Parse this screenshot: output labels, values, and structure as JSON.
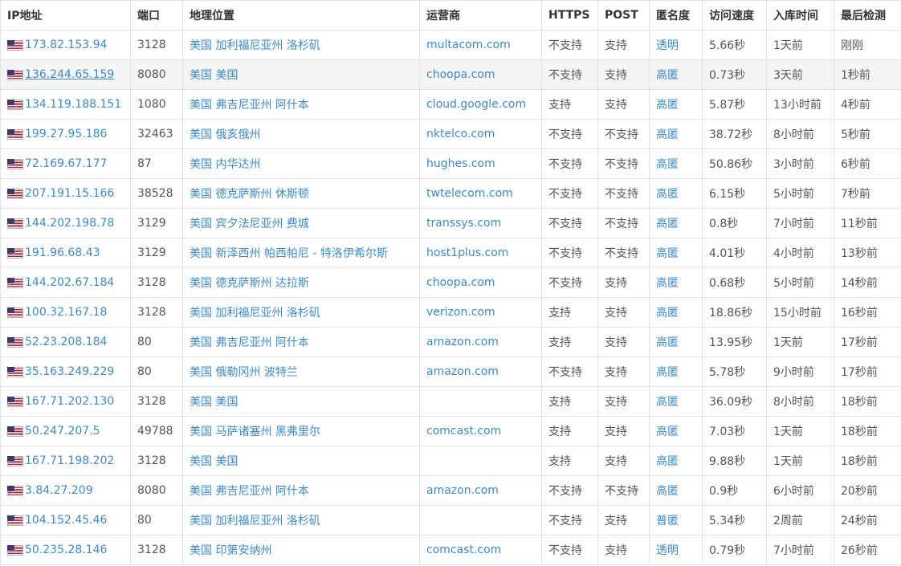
{
  "headers": [
    "IP地址",
    "端口",
    "地理位置",
    "运营商",
    "HTTPS",
    "POST",
    "匿名度",
    "访问速度",
    "入库时间",
    "最后检测"
  ],
  "rows": [
    {
      "ip": "173.82.153.94",
      "port": "3128",
      "location": "美国 加利福尼亚州 洛杉矶",
      "isp": "multacom.com",
      "https": "不支持",
      "post": "支持",
      "anon": "透明",
      "speed": "5.66秒",
      "added": "1天前",
      "checked": "刚刚"
    },
    {
      "ip": "136.244.65.159",
      "port": "8080",
      "location": "美国 美国",
      "isp": "choopa.com",
      "https": "不支持",
      "post": "支持",
      "anon": "高匿",
      "speed": "0.73秒",
      "added": "3天前",
      "checked": "1秒前"
    },
    {
      "ip": "134.119.188.151",
      "port": "1080",
      "location": "美国 弗吉尼亚州 阿什本",
      "isp": "cloud.google.com",
      "https": "支持",
      "post": "支持",
      "anon": "高匿",
      "speed": "5.87秒",
      "added": "13小时前",
      "checked": "4秒前"
    },
    {
      "ip": "199.27.95.186",
      "port": "32463",
      "location": "美国 俄亥俄州",
      "isp": "nktelco.com",
      "https": "不支持",
      "post": "不支持",
      "anon": "高匿",
      "speed": "38.72秒",
      "added": "8小时前",
      "checked": "5秒前"
    },
    {
      "ip": "72.169.67.177",
      "port": "87",
      "location": "美国 内华达州",
      "isp": "hughes.com",
      "https": "不支持",
      "post": "不支持",
      "anon": "高匿",
      "speed": "50.86秒",
      "added": "3小时前",
      "checked": "6秒前"
    },
    {
      "ip": "207.191.15.166",
      "port": "38528",
      "location": "美国 德克萨斯州 休斯顿",
      "isp": "twtelecom.com",
      "https": "不支持",
      "post": "不支持",
      "anon": "高匿",
      "speed": "6.15秒",
      "added": "5小时前",
      "checked": "7秒前"
    },
    {
      "ip": "144.202.198.78",
      "port": "3129",
      "location": "美国 宾夕法尼亚州 费城",
      "isp": "transsys.com",
      "https": "不支持",
      "post": "不支持",
      "anon": "高匿",
      "speed": "0.8秒",
      "added": "7小时前",
      "checked": "11秒前"
    },
    {
      "ip": "191.96.68.43",
      "port": "3129",
      "location": "美国 新泽西州 帕西帕尼 - 特洛伊希尔斯",
      "isp": "host1plus.com",
      "https": "不支持",
      "post": "不支持",
      "anon": "高匿",
      "speed": "4.01秒",
      "added": "4小时前",
      "checked": "13秒前"
    },
    {
      "ip": "144.202.67.184",
      "port": "3128",
      "location": "美国 德克萨斯州 达拉斯",
      "isp": "choopa.com",
      "https": "不支持",
      "post": "支持",
      "anon": "高匿",
      "speed": "0.68秒",
      "added": "5小时前",
      "checked": "14秒前"
    },
    {
      "ip": "100.32.167.18",
      "port": "3128",
      "location": "美国 加利福尼亚州 洛杉矶",
      "isp": "verizon.com",
      "https": "支持",
      "post": "支持",
      "anon": "高匿",
      "speed": "18.86秒",
      "added": "15小时前",
      "checked": "16秒前"
    },
    {
      "ip": "52.23.208.184",
      "port": "80",
      "location": "美国 弗吉尼亚州 阿什本",
      "isp": "amazon.com",
      "https": "支持",
      "post": "支持",
      "anon": "高匿",
      "speed": "13.95秒",
      "added": "1天前",
      "checked": "17秒前"
    },
    {
      "ip": "35.163.249.229",
      "port": "80",
      "location": "美国 俄勒冈州 波特兰",
      "isp": "amazon.com",
      "https": "不支持",
      "post": "支持",
      "anon": "高匿",
      "speed": "5.78秒",
      "added": "9小时前",
      "checked": "17秒前"
    },
    {
      "ip": "167.71.202.130",
      "port": "3128",
      "location": "美国 美国",
      "isp": "",
      "https": "支持",
      "post": "支持",
      "anon": "高匿",
      "speed": "36.09秒",
      "added": "8小时前",
      "checked": "18秒前"
    },
    {
      "ip": "50.247.207.5",
      "port": "49788",
      "location": "美国 马萨诸塞州 黑弗里尔",
      "isp": "comcast.com",
      "https": "支持",
      "post": "支持",
      "anon": "高匿",
      "speed": "7.03秒",
      "added": "1天前",
      "checked": "18秒前"
    },
    {
      "ip": "167.71.198.202",
      "port": "3128",
      "location": "美国 美国",
      "isp": "",
      "https": "支持",
      "post": "支持",
      "anon": "高匿",
      "speed": "9.88秒",
      "added": "1天前",
      "checked": "18秒前"
    },
    {
      "ip": "3.84.27.209",
      "port": "8080",
      "location": "美国 弗吉尼亚州 阿什本",
      "isp": "amazon.com",
      "https": "不支持",
      "post": "不支持",
      "anon": "高匿",
      "speed": "0.9秒",
      "added": "6小时前",
      "checked": "20秒前"
    },
    {
      "ip": "104.152.45.46",
      "port": "80",
      "location": "美国 加利福尼亚州 洛杉矶",
      "isp": "",
      "https": "不支持",
      "post": "支持",
      "anon": "普匿",
      "speed": "5.34秒",
      "added": "2周前",
      "checked": "24秒前"
    },
    {
      "ip": "50.235.28.146",
      "port": "3128",
      "location": "美国 印第安纳州",
      "isp": "comcast.com",
      "https": "不支持",
      "post": "支持",
      "anon": "透明",
      "speed": "0.79秒",
      "added": "7小时前",
      "checked": "26秒前"
    }
  ],
  "colors": {
    "link": "#3a8ac8",
    "text": "#555555",
    "header_text": "#333333",
    "border": "#e2e2e2",
    "highlight_row": "#f5f5f5"
  },
  "icons": {
    "flag": "us-flag-icon"
  }
}
